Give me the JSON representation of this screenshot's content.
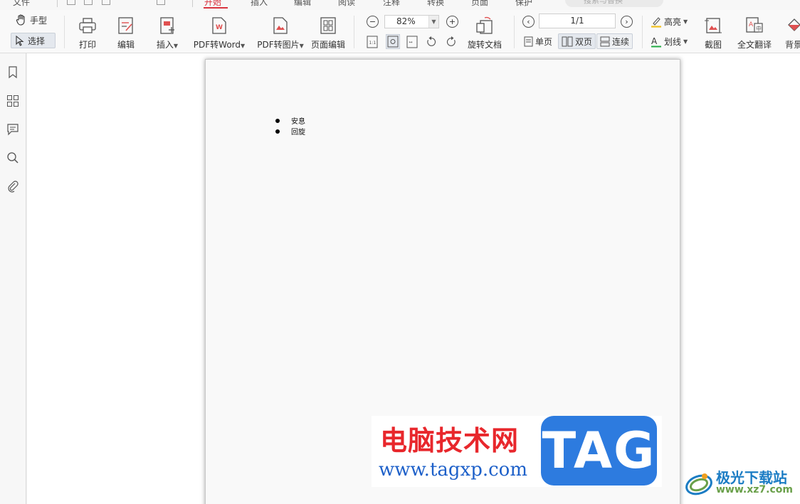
{
  "menu": {
    "items": [
      "文件",
      "开始",
      "插入",
      "编辑",
      "阅读",
      "注释",
      "转换",
      "页面",
      "保护"
    ],
    "search_placeholder": "搜索与替换"
  },
  "toolbar": {
    "hand_label": "手型",
    "select_label": "选择",
    "print_label": "打印",
    "edit_label": "编辑",
    "insert_label": "插入",
    "pdf2word_label": "PDF转Word",
    "pdf2image_label": "PDF转图片",
    "page_edit_label": "页面编辑",
    "zoom_value": "82%",
    "rotate_doc_label": "旋转文档",
    "page_value": "1/1",
    "single_label": "单页",
    "double_label": "双页",
    "continuous_label": "连续",
    "highlight_label": "高亮",
    "strike_label": "划线",
    "screenshot_label": "截图",
    "translate_label": "全文翻译",
    "background_label": "背景"
  },
  "document": {
    "bullets": [
      "安息",
      "回旋"
    ]
  },
  "watermark": {
    "cn_text": "电脑技术网",
    "url_text": "www.tagxp.com",
    "tag_text": "TAG"
  },
  "brand": {
    "title": "极光下载站",
    "url": "www.xz7.com"
  },
  "colors": {
    "accent": "#d9333f",
    "watermark_red": "#e8272c",
    "watermark_blue": "#2d7bdf"
  }
}
